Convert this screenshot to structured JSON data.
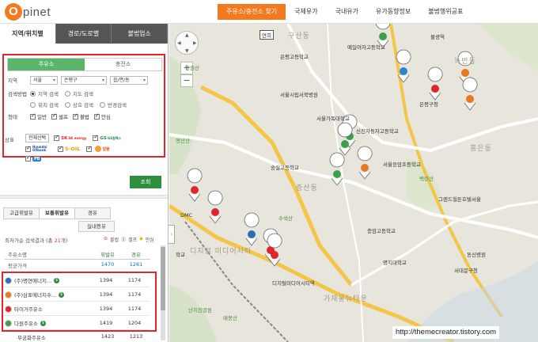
{
  "app": {
    "logo_letter": "O",
    "logo_text": "pinet"
  },
  "topnav": [
    {
      "label": "주유소/충전소 찾기",
      "active": true
    },
    {
      "label": "국제유가"
    },
    {
      "label": "국내유가"
    },
    {
      "label": "유가동향정보"
    },
    {
      "label": "불법행위공표"
    }
  ],
  "left_tabs": [
    {
      "label": "지역/위치별",
      "active": true
    },
    {
      "label": "경로/도로별"
    },
    {
      "label": "불법업소"
    }
  ],
  "search": {
    "subtabs": [
      "주유소",
      "충전소"
    ],
    "region_label": "지역",
    "region_values": [
      "서울",
      "은평구",
      "읍/면/동"
    ],
    "method_label": "검색방법",
    "methods": [
      "지역 검색",
      "지도 검색",
      "위치 검색",
      "상호 검색",
      "반경검색"
    ],
    "type_label": "형태",
    "types": [
      "일반",
      "셀프",
      "불법",
      "안심"
    ],
    "brand_label": "상표",
    "brand_all_button": "전체선택",
    "brands": [
      "SK",
      "GS",
      "S-OIL",
      "알뜰",
      "PB"
    ],
    "brand_texts": [
      "SK energy",
      "GS칼텍스",
      "Hyundai Oilbank",
      "S-OIL"
    ],
    "search_button": "조회"
  },
  "fuel_tabs": [
    "고급휘발유",
    "보통휘발유",
    "경유"
  ],
  "fuel_tab_extra": "실내등유",
  "results": {
    "summary_prefix": "최저가순 검색결과 (총 ",
    "count": "21",
    "summary_suffix": "개)",
    "legend": [
      "불법",
      "셀프",
      "안심"
    ],
    "columns": [
      "주유소명",
      "휘발유",
      "경유"
    ],
    "average": {
      "name": "평균가격",
      "gasoline": "1470",
      "diesel": "1261"
    },
    "rows": [
      {
        "name": "(주)명연에너지...",
        "gasoline": "1394",
        "diesel": "1174",
        "color": "#2a6fb5"
      },
      {
        "name": "(주)삼표에너지수...",
        "gasoline": "1394",
        "diesel": "1174",
        "color": "#e87722"
      },
      {
        "name": "타이거주유소",
        "gasoline": "1394",
        "diesel": "1174",
        "color": "#e0262b"
      },
      {
        "name": "다원주유소",
        "gasoline": "1419",
        "diesel": "1204",
        "color": "#3aa04a"
      }
    ],
    "last_row": {
      "name": "무궁화주유소",
      "gasoline": "1423",
      "diesel": "1213"
    }
  },
  "map": {
    "zoom_in": "+",
    "zoom_out": "−",
    "watermark": "http://themecreator.tistory.com"
  }
}
